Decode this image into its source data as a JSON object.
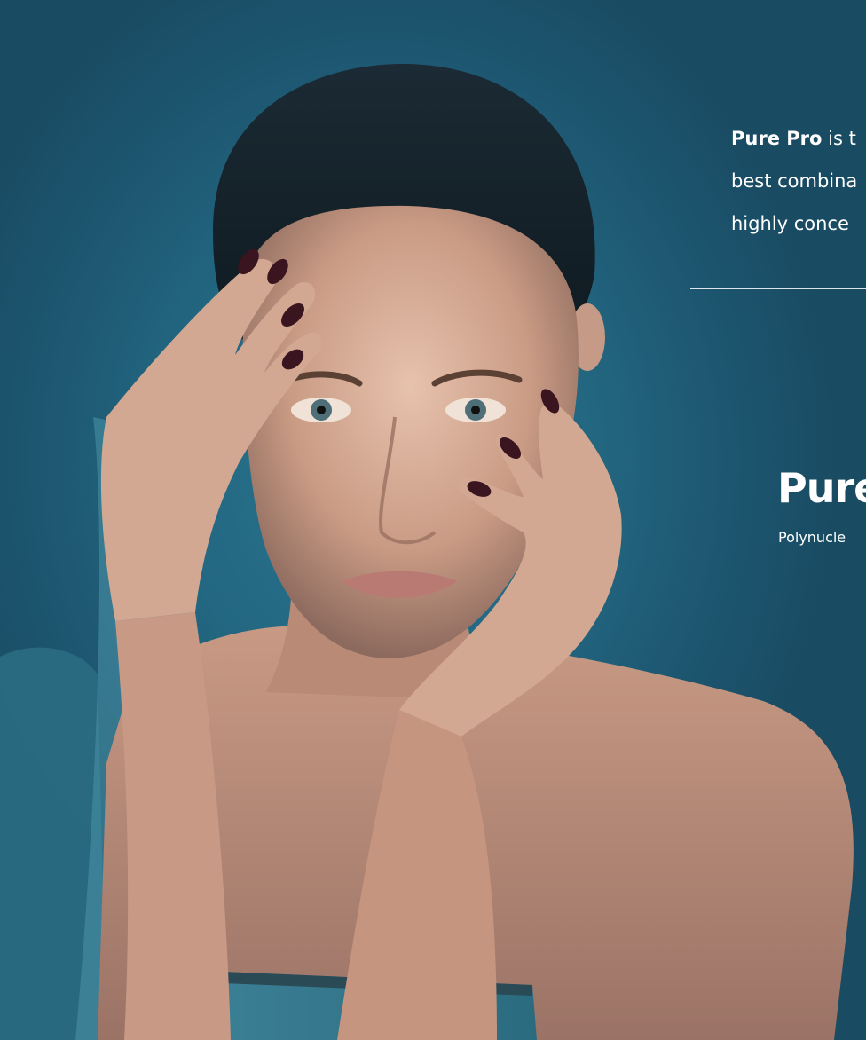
{
  "copy": {
    "line1_bold": "Pure Pro",
    "line1_rest": " is t",
    "line2": "best combina",
    "line3": "highly conce"
  },
  "brand": {
    "name": "Pure",
    "tagline": "Polynucle"
  },
  "colors": {
    "background": "#1f5a73",
    "text": "#ffffff"
  },
  "photo": {
    "subject": "woman-portrait"
  }
}
